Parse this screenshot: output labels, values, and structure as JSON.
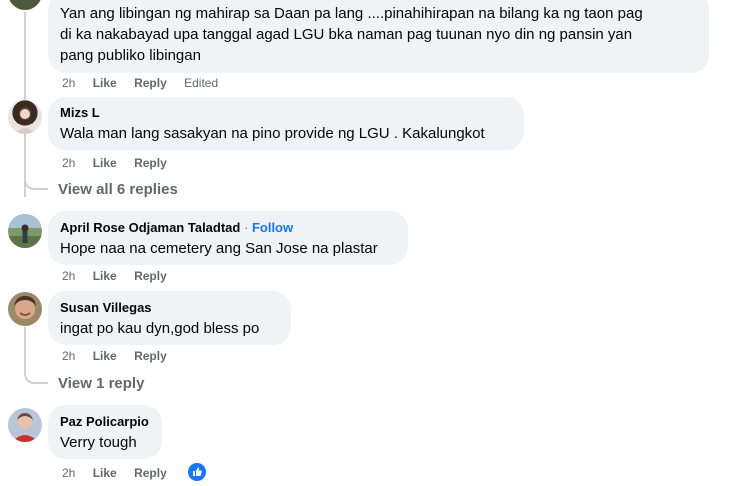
{
  "comments": [
    {
      "id": "c0",
      "lines": [
        "Yan ang libingan ng mahirap sa Daan pa lang ....pinahihirapan na bilang ka ng taon pag",
        "di ka nakabayad upa tanggal agad LGU bka naman pag tuunan nyo din ng pansin yan",
        "pang publiko libingan"
      ],
      "time": "2h",
      "like": "Like",
      "reply": "Reply",
      "edited": "Edited"
    },
    {
      "id": "c1",
      "author": "Mizs L",
      "text": "Wala man lang sasakyan na pino provide ng LGU . Kakalungkot",
      "time": "2h",
      "like": "Like",
      "reply": "Reply",
      "view_replies": "View all 6 replies"
    },
    {
      "id": "c2",
      "author": "April Rose Odjaman Taladtad",
      "follow_sep": "·",
      "follow": "Follow",
      "text": "Hope naa na cemetery ang San Jose na plastar",
      "time": "2h",
      "like": "Like",
      "reply": "Reply"
    },
    {
      "id": "c3",
      "author": "Susan Villegas",
      "text": "ingat po kau dyn,god bless po",
      "time": "2h",
      "like": "Like",
      "reply": "Reply",
      "view_replies": "View 1 reply"
    },
    {
      "id": "c4",
      "author": "Paz Policarpio",
      "text": "Verry tough",
      "time": "2h",
      "like": "Like",
      "reply": "Reply"
    }
  ],
  "avatars": {
    "c1": "avatar-woman-portrait",
    "c2": "avatar-outdoor-photo",
    "c3": "avatar-woman-smiling",
    "c4": "avatar-woman-red-top"
  },
  "reaction": {
    "icon": "like-reaction-icon",
    "color": "#1877f2"
  }
}
